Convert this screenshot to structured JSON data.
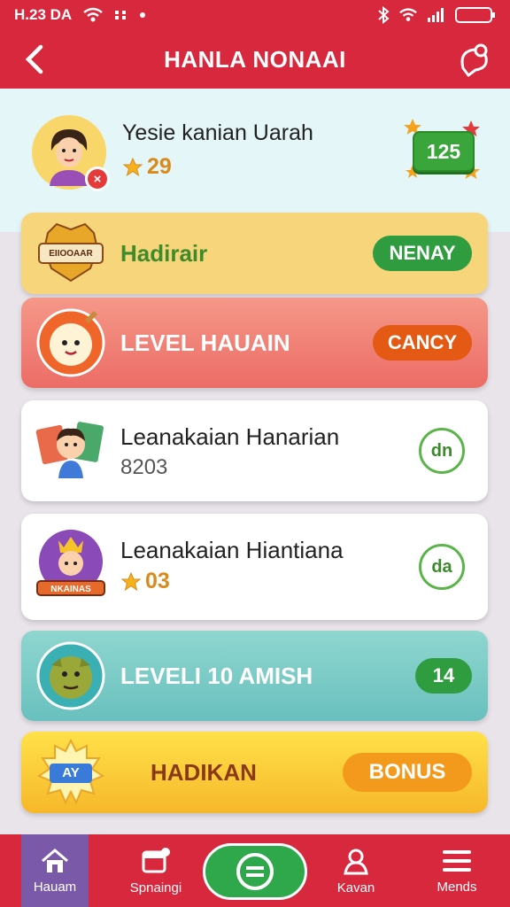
{
  "status": {
    "time": "H.23 DA"
  },
  "header": {
    "title": "HANLA NONAAI"
  },
  "profile": {
    "name": "Yesie kanian Uarah",
    "stars": "29",
    "score": "125"
  },
  "cards": [
    {
      "label": "Hadirair",
      "badge_text": "EIIOOAAR",
      "button": "NENAY"
    },
    {
      "label": "LEVEL HAUAIN",
      "button": "CANCY"
    },
    {
      "label": "Leanakaian Hanarian",
      "value": "8203",
      "button": "dn"
    },
    {
      "label": "Leanakaian Hiantiana",
      "badge_text": "NKAINAS",
      "value": "03",
      "button": "da"
    },
    {
      "label": "LEVELI 10 AMISH",
      "button": "14"
    },
    {
      "label": "HADIKAN",
      "badge_text": "AY",
      "button": "BONUS"
    }
  ],
  "nav": [
    {
      "label": "Hauam"
    },
    {
      "label": "Spnaingi"
    },
    {
      "label": "Kavan"
    },
    {
      "label": "Mends"
    }
  ],
  "colors": {
    "primary": "#d8283e",
    "accent_green": "#2f9c40",
    "active_nav": "#7a59a8"
  }
}
